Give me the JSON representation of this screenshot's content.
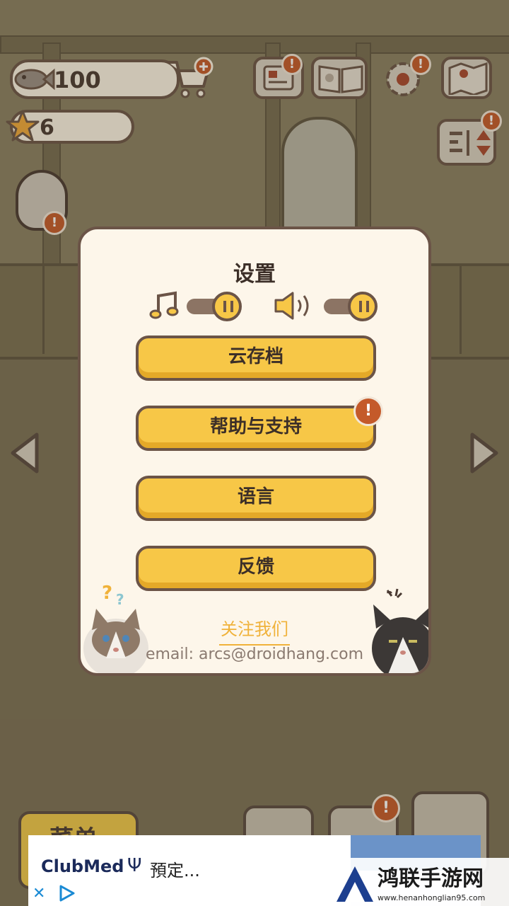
{
  "hud": {
    "fish_count": "100",
    "star_count": "6"
  },
  "dialog": {
    "title": "设置",
    "buttons": [
      "云存档",
      "帮助与支持",
      "语言",
      "反馈"
    ],
    "follow_label": "关注我们",
    "email": "email: arcs@droidhang.com",
    "alert_glyph": "!"
  },
  "bottom": {
    "menu_label": "菜单"
  },
  "ad": {
    "brand": "ClubMed",
    "trident": "Ψ",
    "cta": "預定...",
    "close_glyph": "✕"
  },
  "watermark": {
    "title": "鸿联手游网",
    "url": "www.henanhonglian95.com"
  },
  "colors": {
    "accent_yellow": "#f7c747",
    "outline_brown": "#6b5447",
    "alert_orange": "#c45a2a",
    "dialog_bg": "#fdf6ea"
  },
  "icons": [
    "fish-icon",
    "cart-add-icon",
    "star-icon",
    "mail-icon",
    "book-icon",
    "gear-icon",
    "map-icon",
    "sort-icon",
    "music-note-icon",
    "speaker-icon",
    "left-arrow-icon",
    "right-arrow-icon"
  ]
}
